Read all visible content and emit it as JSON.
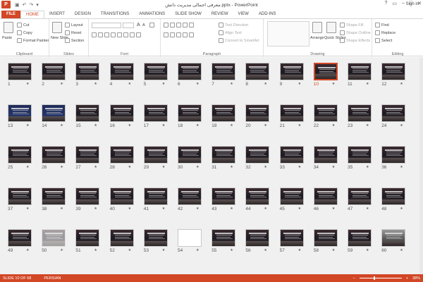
{
  "titlebar": {
    "app_logo": "P",
    "title": "معرفی اجمالی مدیریت دانش.pptx - PowerPoint",
    "undo": "↶",
    "redo": "↷",
    "save": "▣",
    "qat_more": "▾",
    "help": "?",
    "ribbon_display": "▭",
    "minimize": "–",
    "maximize": "□",
    "close": "✕"
  },
  "tabs": [
    "FILE",
    "HOME",
    "INSERT",
    "DESIGN",
    "TRANSITIONS",
    "ANIMATIONS",
    "SLIDE SHOW",
    "REVIEW",
    "VIEW",
    "ADD-INS"
  ],
  "active_tab": "HOME",
  "signin": "Sign in",
  "ribbon": {
    "clipboard": {
      "label": "Clipboard",
      "paste": "Paste",
      "cut": "Cut",
      "copy": "Copy",
      "format_painter": "Format Painter"
    },
    "slides": {
      "label": "Slides",
      "new_slide": "New Slide",
      "layout": "Layout",
      "reset": "Reset",
      "section": "Section"
    },
    "font": {
      "label": "Font",
      "font_size_up": "A",
      "font_size_down": "A"
    },
    "paragraph": {
      "label": "Paragraph",
      "text_direction": "Text Direction",
      "align_text": "Align Text",
      "convert_smartart": "Convert to SmartArt"
    },
    "drawing": {
      "label": "Drawing",
      "arrange": "Arrange",
      "quick_styles": "Quick Styles",
      "shape_fill": "Shape Fill",
      "shape_outline": "Shape Outline",
      "shape_effects": "Shape Effects"
    },
    "editing": {
      "label": "Editing",
      "find": "Find",
      "replace": "Replace",
      "select": "Select"
    }
  },
  "slides": {
    "selected": 10,
    "star": "★",
    "numbers": [
      "1",
      "2",
      "3",
      "4",
      "5",
      "6",
      "7",
      "8",
      "9",
      "10",
      "11",
      "12",
      "13",
      "14",
      "15",
      "16",
      "17",
      "18",
      "19",
      "20",
      "21",
      "22",
      "23",
      "24",
      "25",
      "26",
      "27",
      "28",
      "29",
      "30",
      "31",
      "32",
      "33",
      "34",
      "35",
      "36",
      "37",
      "38",
      "39",
      "40",
      "41",
      "42",
      "43",
      "44",
      "45",
      "46",
      "47",
      "48",
      "49",
      "50",
      "51",
      "52",
      "53",
      "54",
      "55",
      "56",
      "57",
      "58",
      "59",
      "60"
    ]
  },
  "status": {
    "slide_info": "SLIDE 10 OF 68",
    "language": "PERSIAN",
    "zoom": "38%",
    "zoom_minus": "–",
    "zoom_plus": "+"
  },
  "colors": {
    "accent": "#d24726",
    "selected_border": "#d24726"
  }
}
